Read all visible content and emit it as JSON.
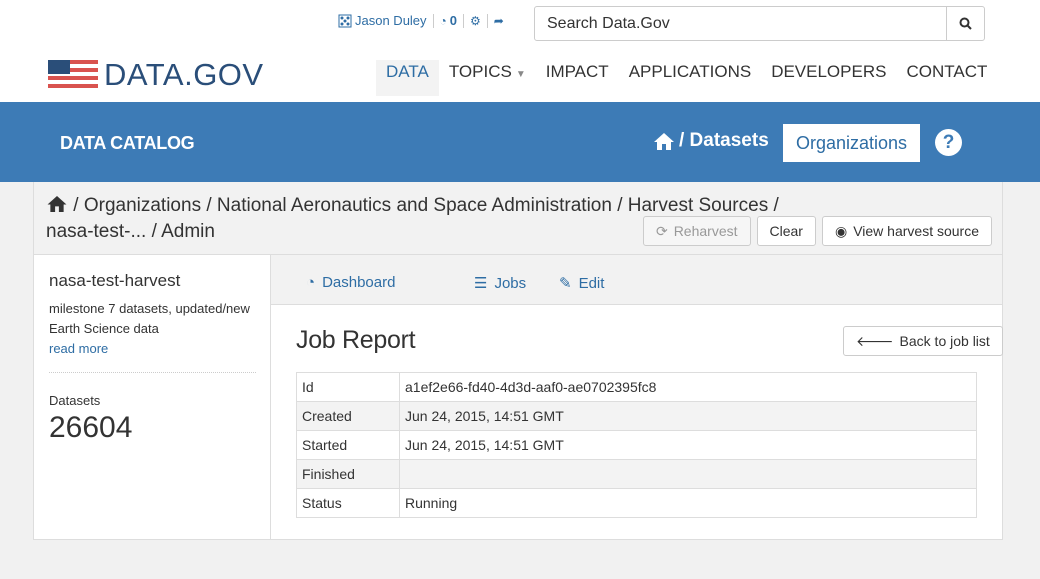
{
  "header": {
    "user_name": "Jason Duley",
    "activity_count": "0",
    "search_placeholder": "Search Data.Gov",
    "logo_text": "DATA.GOV",
    "nav": [
      "DATA",
      "TOPICS",
      "IMPACT",
      "APPLICATIONS",
      "DEVELOPERS",
      "CONTACT"
    ],
    "active_nav": "DATA"
  },
  "catalog": {
    "title": "DATA CATALOG",
    "crumb_datasets": "/ Datasets",
    "organizations_btn": "Organizations",
    "help": "?"
  },
  "page": {
    "breadcrumb_line1": " / Organizations / National Aeronautics and Space Administration / Harvest Sources /",
    "breadcrumb_line2": "nasa-test-... / Admin",
    "actions": {
      "reharvest": "Reharvest",
      "clear": "Clear",
      "view_source": "View harvest source"
    }
  },
  "sidebar": {
    "name": "nasa-test-harvest",
    "description": "milestone 7 datasets, updated/new Earth Science data",
    "read_more": "read more",
    "datasets_label": "Datasets",
    "datasets_count": "26604"
  },
  "tabs": {
    "dashboard": "Dashboard",
    "jobs": "Jobs",
    "edit": "Edit"
  },
  "job_report": {
    "title": "Job Report",
    "back_btn": "Back to job list",
    "rows": [
      {
        "key": "Id",
        "value": "a1ef2e66-fd40-4d3d-aaf0-ae0702395fc8"
      },
      {
        "key": "Created",
        "value": "Jun 24, 2015, 14:51 GMT"
      },
      {
        "key": "Started",
        "value": "Jun 24, 2015, 14:51 GMT"
      },
      {
        "key": "Finished",
        "value": ""
      },
      {
        "key": "Status",
        "value": "Running"
      }
    ]
  },
  "colors": {
    "brand_blue": "#3d7bb6",
    "link_blue": "#2e6da4",
    "logo_navy": "#2a4e79"
  }
}
